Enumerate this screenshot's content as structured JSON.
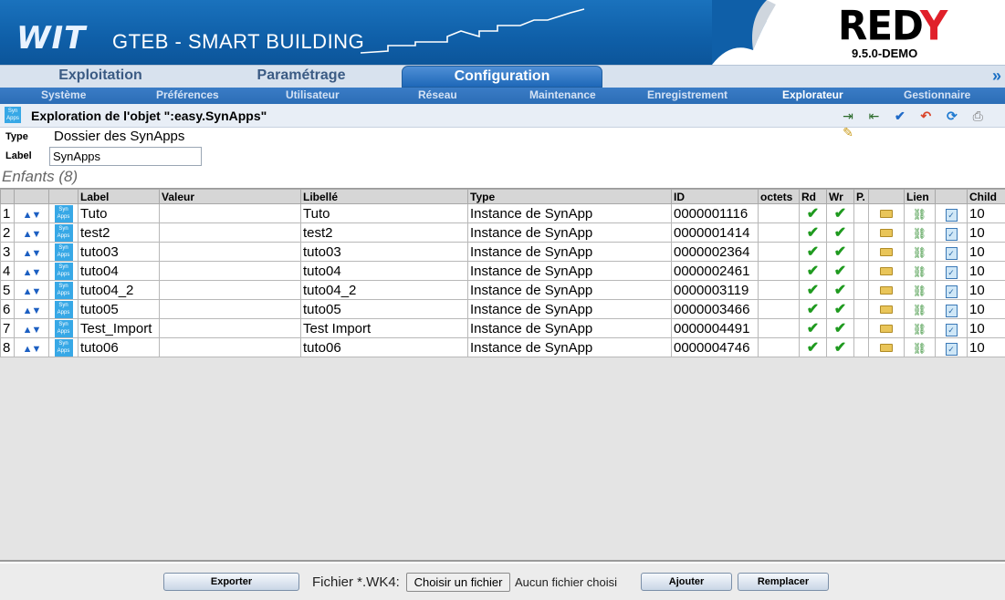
{
  "app": {
    "brand": "WIT",
    "title": "GTEB - SMART BUILDING",
    "product_logo": "REDY",
    "version": "9.5.0-DEMO"
  },
  "tabs": [
    {
      "label": "Exploitation",
      "active": false
    },
    {
      "label": "Paramétrage",
      "active": false
    },
    {
      "label": "Configuration",
      "active": true
    }
  ],
  "subnav": [
    {
      "label": "Système",
      "active": false
    },
    {
      "label": "Préférences",
      "active": false
    },
    {
      "label": "Utilisateur",
      "active": false
    },
    {
      "label": "Réseau",
      "active": false
    },
    {
      "label": "Maintenance",
      "active": false
    },
    {
      "label": "Enregistrement",
      "active": false
    },
    {
      "label": "Explorateur",
      "active": true
    },
    {
      "label": "Gestionnaire",
      "active": false
    }
  ],
  "object": {
    "title": "Exploration de l'objet \":easy.SynApps\"",
    "icon_text": "Syn Apps",
    "type_label": "Type",
    "type_value": "Dossier des SynApps",
    "label_label": "Label",
    "label_value": "SynApps"
  },
  "toolbar_icons": [
    "export-icon",
    "import-icon",
    "validate-icon",
    "undo-icon",
    "refresh-icon",
    "print-icon",
    "properties-icon"
  ],
  "children": {
    "title": "Enfants (8)",
    "columns": [
      "",
      "",
      "",
      "Label",
      "Valeur",
      "Libellé",
      "Type",
      "ID",
      "octets",
      "Rd",
      "Wr",
      "P.",
      "",
      "Lien",
      "",
      "Child"
    ],
    "rows": [
      {
        "n": "1",
        "label": "Tuto",
        "valeur": "",
        "libelle": "Tuto",
        "type": "Instance de SynApp",
        "id": "0000001116",
        "octets": "",
        "child": "10"
      },
      {
        "n": "2",
        "label": "test2",
        "valeur": "",
        "libelle": "test2",
        "type": "Instance de SynApp",
        "id": "0000001414",
        "octets": "",
        "child": "10"
      },
      {
        "n": "3",
        "label": "tuto03",
        "valeur": "",
        "libelle": "tuto03",
        "type": "Instance de SynApp",
        "id": "0000002364",
        "octets": "",
        "child": "10"
      },
      {
        "n": "4",
        "label": "tuto04",
        "valeur": "",
        "libelle": "tuto04",
        "type": "Instance de SynApp",
        "id": "0000002461",
        "octets": "",
        "child": "10"
      },
      {
        "n": "5",
        "label": "tuto04_2",
        "valeur": "",
        "libelle": "tuto04_2",
        "type": "Instance de SynApp",
        "id": "0000003119",
        "octets": "",
        "child": "10"
      },
      {
        "n": "6",
        "label": "tuto05",
        "valeur": "",
        "libelle": "tuto05",
        "type": "Instance de SynApp",
        "id": "0000003466",
        "octets": "",
        "child": "10"
      },
      {
        "n": "7",
        "label": "Test_Import",
        "valeur": "",
        "libelle": "Test Import",
        "type": "Instance de SynApp",
        "id": "0000004491",
        "octets": "",
        "child": "10"
      },
      {
        "n": "8",
        "label": "tuto06",
        "valeur": "",
        "libelle": "tuto06",
        "type": "Instance de SynApp",
        "id": "0000004746",
        "octets": "",
        "child": "10"
      }
    ]
  },
  "footer": {
    "export_label": "Exporter",
    "file_label": "Fichier *.WK4:",
    "choose_file_label": "Choisir un fichier",
    "no_file_label": "Aucun fichier choisi",
    "add_label": "Ajouter",
    "replace_label": "Remplacer"
  },
  "colors": {
    "banner_blue": "#0f5fa8",
    "active_tab": "#1e68b8",
    "subnav": "#2c6db6",
    "check_green": "#1f9a1f",
    "logo_red": "#e0202a"
  }
}
